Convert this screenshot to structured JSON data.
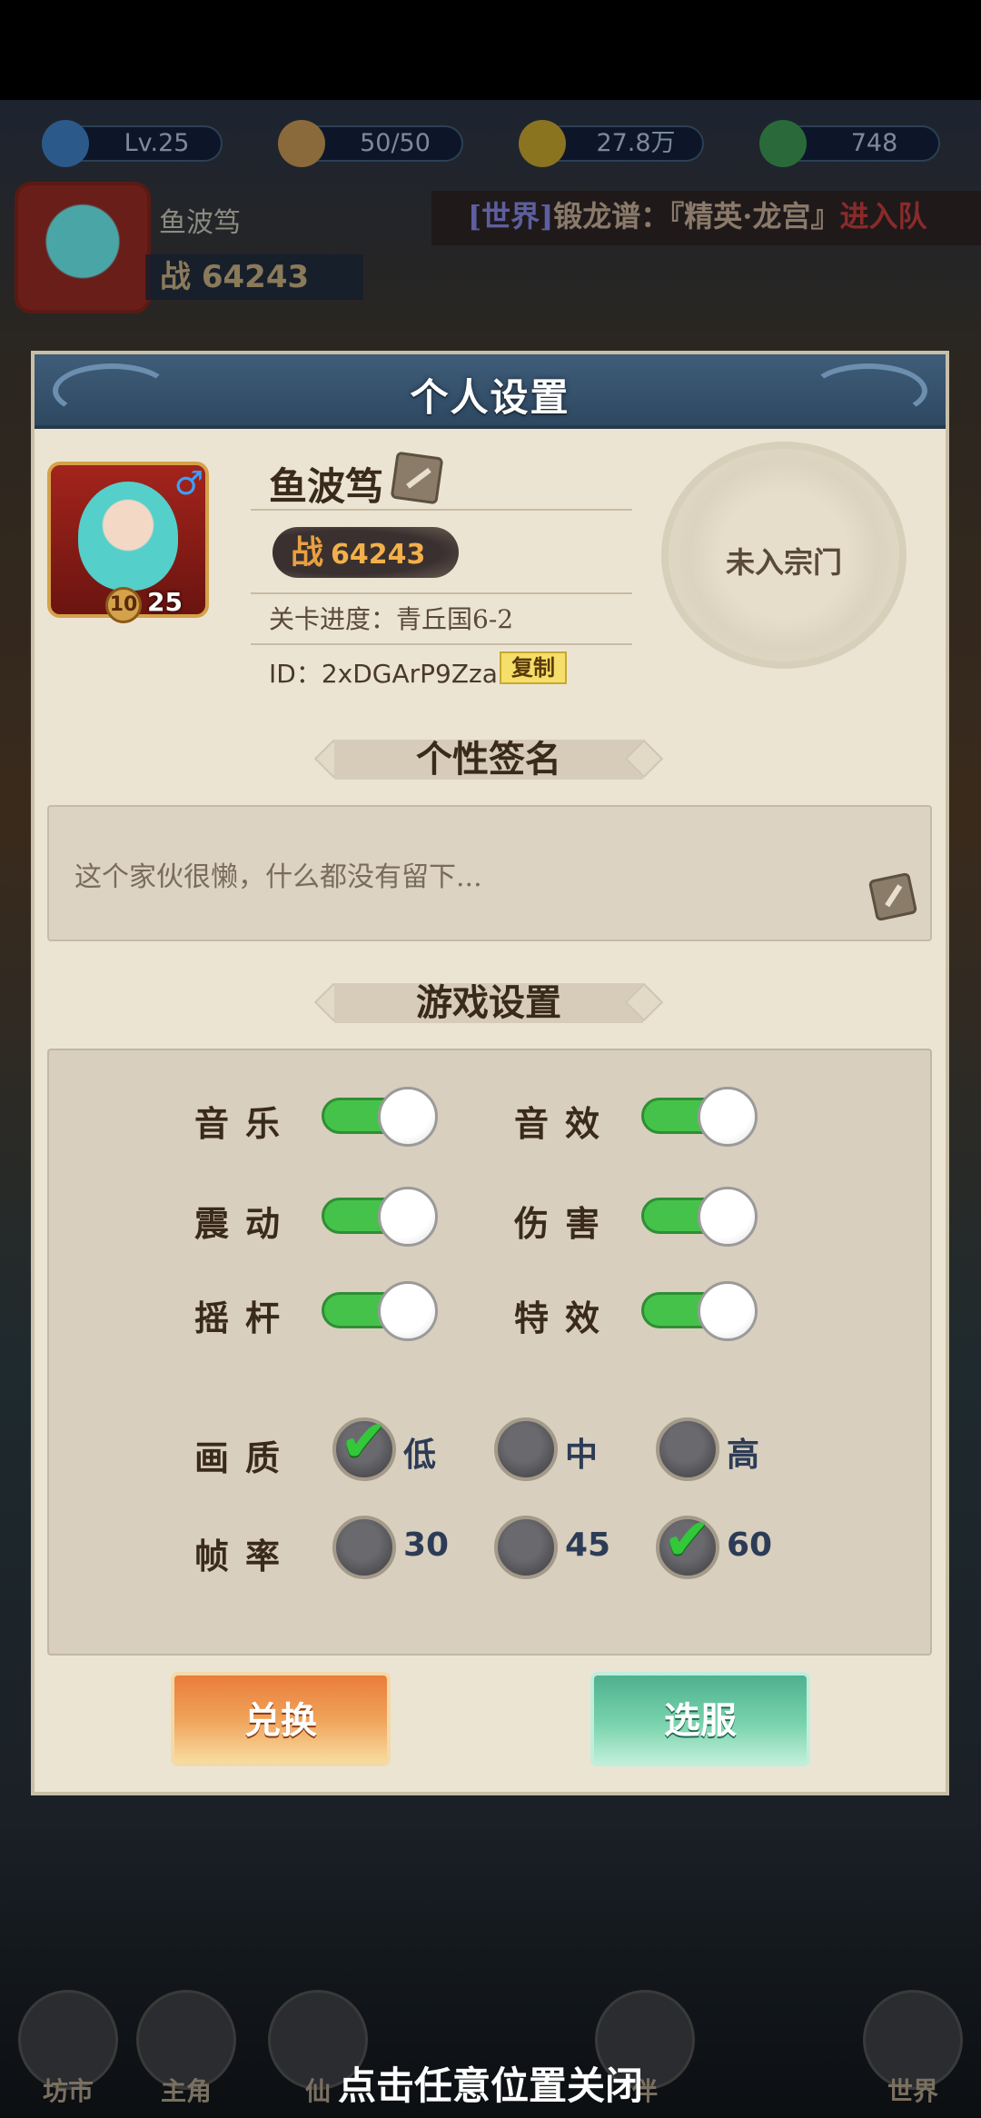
{
  "resources": {
    "level": "Lv.25",
    "stamina": "50/50",
    "coins": "27.8万",
    "jade": "748"
  },
  "player_bar": {
    "name": "鱼波笃",
    "power_label": "战",
    "power": "64243",
    "ticker_channel": "[世界]",
    "ticker_message": "锻龙谱：『精英·龙宫』",
    "ticker_action": "进入队"
  },
  "modal": {
    "title": "个人设置",
    "avatar_level_badge": "10",
    "avatar_level": "25",
    "gender_symbol": "♂",
    "player_name": "鱼波笃",
    "power_label": "战",
    "power": "64243",
    "progress": "关卡进度：青丘国6-2",
    "id": "ID：2xDGArP9Zza",
    "copy_label": "复制",
    "guild": "未入宗门",
    "signature_title": "个性签名",
    "signature_text": "这个家伙很懒，什么都没有留下...",
    "game_settings_title": "游戏设置"
  },
  "settings": {
    "toggles": [
      {
        "label": "音乐",
        "on": true
      },
      {
        "label": "音效",
        "on": true
      },
      {
        "label": "震动",
        "on": true
      },
      {
        "label": "伤害",
        "on": true
      },
      {
        "label": "摇杆",
        "on": true
      },
      {
        "label": "特效",
        "on": true
      }
    ],
    "quality": {
      "label": "画质",
      "options": [
        "低",
        "中",
        "高"
      ],
      "selected": "低"
    },
    "framerate": {
      "label": "帧率",
      "options": [
        "30",
        "45",
        "60"
      ],
      "selected": "60"
    }
  },
  "buttons": {
    "redeem": "兑换",
    "select_server": "选服"
  },
  "bottom_nav": [
    "坊市",
    "主角",
    "仙",
    "伴",
    "世界"
  ],
  "close_hint": "点击任意位置关闭",
  "colors": {
    "toggle_on": "#45c24a",
    "header_blue": "#3f5d79",
    "redeem_orange": "#e97d3a",
    "server_green": "#4fb190",
    "panel": "#ece4d2"
  }
}
